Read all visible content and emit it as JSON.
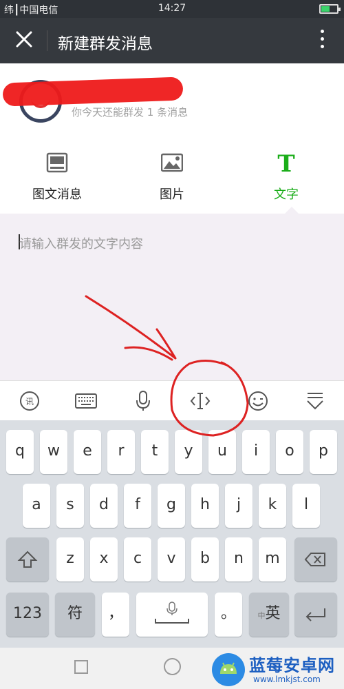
{
  "status_bar": {
    "signal": "纬┃中国电信",
    "time": "14:27",
    "battery_level": 0.55
  },
  "header": {
    "title": "新建群发消息",
    "close_icon": "close-icon",
    "more_icon": "more-vertical-icon"
  },
  "account": {
    "remaining_text": "你今天还能群发 1 条消息"
  },
  "tabs": [
    {
      "label": "图文消息",
      "icon": "article-icon",
      "active": false
    },
    {
      "label": "图片",
      "icon": "image-icon",
      "active": false
    },
    {
      "label": "文字",
      "icon": "text-T-icon",
      "active": true
    }
  ],
  "compose": {
    "placeholder": "请输入群发的文字内容"
  },
  "keyboard_toolbar": [
    "handwriting-icon",
    "keyboard-icon",
    "microphone-icon",
    "cursor-move-icon",
    "emoji-icon",
    "collapse-keyboard-icon"
  ],
  "keyboard": {
    "row1": [
      "q",
      "w",
      "e",
      "r",
      "t",
      "y",
      "u",
      "i",
      "o",
      "p"
    ],
    "row2": [
      "a",
      "s",
      "d",
      "f",
      "g",
      "h",
      "j",
      "k",
      "l"
    ],
    "row3": [
      "z",
      "x",
      "c",
      "v",
      "b",
      "n",
      "m"
    ],
    "num_label": "123",
    "symbol_label": "符",
    "comma": "，",
    "period": "。",
    "lang_small": "中",
    "lang_label": "英"
  },
  "watermark": {
    "title": "蓝莓安卓网",
    "url": "www.lmkjst.com"
  },
  "colors": {
    "header_bg": "#35393e",
    "accent_green": "#1aad19",
    "annotation_red": "#d22"
  }
}
